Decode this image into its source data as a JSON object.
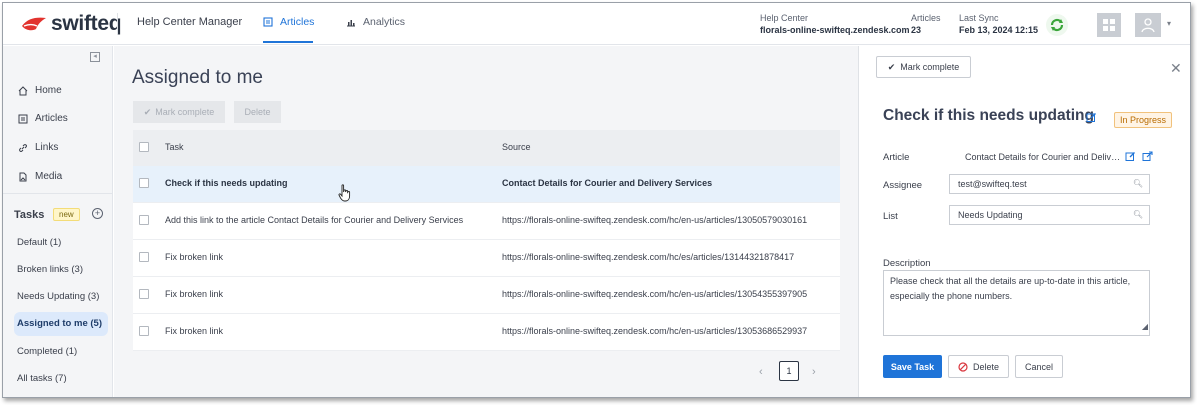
{
  "header": {
    "brand": "swifteq",
    "app_title": "Help Center Manager",
    "tabs": [
      {
        "label": "Articles",
        "icon": "article-icon",
        "active": true
      },
      {
        "label": "Analytics",
        "icon": "bar-chart-icon",
        "active": false
      }
    ],
    "help_center": {
      "label": "Help Center",
      "value": "florals-online-swifteq.zendesk.com"
    },
    "articles": {
      "label": "Articles",
      "value": "23"
    },
    "last_sync": {
      "label": "Last Sync",
      "value": "Feb 13, 2024 12:15"
    },
    "colors": {
      "brand_red": "#e2332e",
      "accent": "#1f74d8",
      "sync_green": "#3aa53a"
    }
  },
  "sidebar": {
    "nav": [
      {
        "label": "Home",
        "icon": "home-icon"
      },
      {
        "label": "Articles",
        "icon": "article-icon"
      },
      {
        "label": "Links",
        "icon": "link-icon"
      },
      {
        "label": "Media",
        "icon": "media-icon"
      }
    ],
    "tasks_heading": "Tasks",
    "new_badge": "new",
    "task_lists": [
      {
        "label": "Default (1)",
        "selected": false
      },
      {
        "label": "Broken links (3)",
        "selected": false
      },
      {
        "label": "Needs Updating (3)",
        "selected": false
      },
      {
        "label": "Assigned to me (5)",
        "selected": true
      },
      {
        "label": "Completed (1)",
        "selected": false
      },
      {
        "label": "All tasks (7)",
        "selected": false
      }
    ]
  },
  "main": {
    "title": "Assigned to me",
    "mark_complete": "Mark complete",
    "delete": "Delete",
    "columns": {
      "task": "Task",
      "source": "Source"
    },
    "rows": [
      {
        "task": "Check if this needs updating",
        "source": "Contact Details for Courier and Delivery Services",
        "highlighted": true
      },
      {
        "task": "Add this link to the article Contact Details for Courier and Delivery Services",
        "source": "https://florals-online-swifteq.zendesk.com/hc/en-us/articles/13050579030161",
        "highlighted": false
      },
      {
        "task": "Fix broken link",
        "source": "https://florals-online-swifteq.zendesk.com/hc/es/articles/13144321878417",
        "highlighted": false
      },
      {
        "task": "Fix broken link",
        "source": "https://florals-online-swifteq.zendesk.com/hc/en-us/articles/13054355397905",
        "highlighted": false
      },
      {
        "task": "Fix broken link",
        "source": "https://florals-online-swifteq.zendesk.com/hc/en-us/articles/13053686529937",
        "highlighted": false
      }
    ],
    "pagination": {
      "current_page": "1"
    }
  },
  "panel": {
    "mark_complete": "Mark complete",
    "title": "Check if this needs updating",
    "status": "In Progress",
    "article_label": "Article",
    "article_value": "Contact Details for Courier and Delivery Services",
    "assignee_label": "Assignee",
    "assignee_value": "test@swifteq.test",
    "list_label": "List",
    "list_value": "Needs Updating",
    "description_label": "Description",
    "description_value": "Please check that all the details are up-to-date in this article, especially the phone numbers.",
    "save": "Save Task",
    "delete": "Delete",
    "cancel": "Cancel"
  }
}
